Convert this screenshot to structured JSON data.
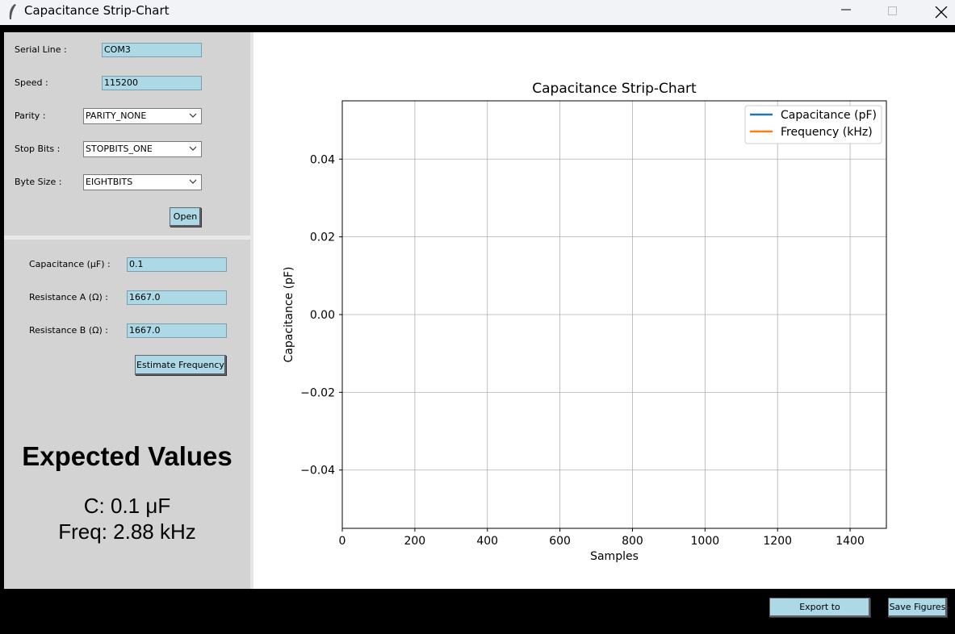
{
  "window": {
    "title": "Capacitance Strip-Chart"
  },
  "serial": {
    "serial_line_label": "Serial Line :",
    "serial_line_value": "COM3",
    "speed_label": "Speed :",
    "speed_value": "115200",
    "parity_label": "Parity :",
    "parity_value": "PARITY_NONE",
    "stop_bits_label": "Stop Bits :",
    "stop_bits_value": "STOPBITS_ONE",
    "byte_size_label": "Byte Size :",
    "byte_size_value": "EIGHTBITS",
    "open_label": "Open"
  },
  "circuit": {
    "capacitance_label": "Capacitance (μF) :",
    "capacitance_value": "0.1",
    "resistance_a_label": "Resistance A (Ω) :",
    "resistance_a_value": "1667.0",
    "resistance_b_label": "Resistance B (Ω) :",
    "resistance_b_value": "1667.0",
    "estimate_label": "Estimate Frequency"
  },
  "expected": {
    "title": "Expected Values",
    "capacitance": "C: 0.1 μF",
    "frequency": "Freq: 2.88 kHz"
  },
  "footer": {
    "export_label": "Export to Spreadsheet",
    "save_label": "Save Figures"
  },
  "chart_data": {
    "type": "line",
    "title": "Capacitance Strip-Chart",
    "xlabel": "Samples",
    "ylabel": "Capacitance (pF)",
    "xlim": [
      0,
      1500
    ],
    "ylim": [
      -0.055,
      0.055
    ],
    "x_ticks": [
      0,
      200,
      400,
      600,
      800,
      1000,
      1200,
      1400
    ],
    "y_ticks": [
      0.04,
      0.02,
      0.0,
      -0.02,
      -0.04
    ],
    "x_tick_labels": [
      "0",
      "200",
      "400",
      "600",
      "800",
      "1000",
      "1200",
      "1400"
    ],
    "y_tick_labels": [
      "0.04",
      "0.02",
      "0.00",
      "−0.02",
      "−0.04"
    ],
    "grid": true,
    "legend_position": "top-right",
    "series": [
      {
        "name": "Capacitance (pF)",
        "color": "#1f77b4",
        "x": [],
        "y": []
      },
      {
        "name": "Frequency (kHz)",
        "color": "#ff7f0e",
        "x": [],
        "y": []
      }
    ]
  }
}
